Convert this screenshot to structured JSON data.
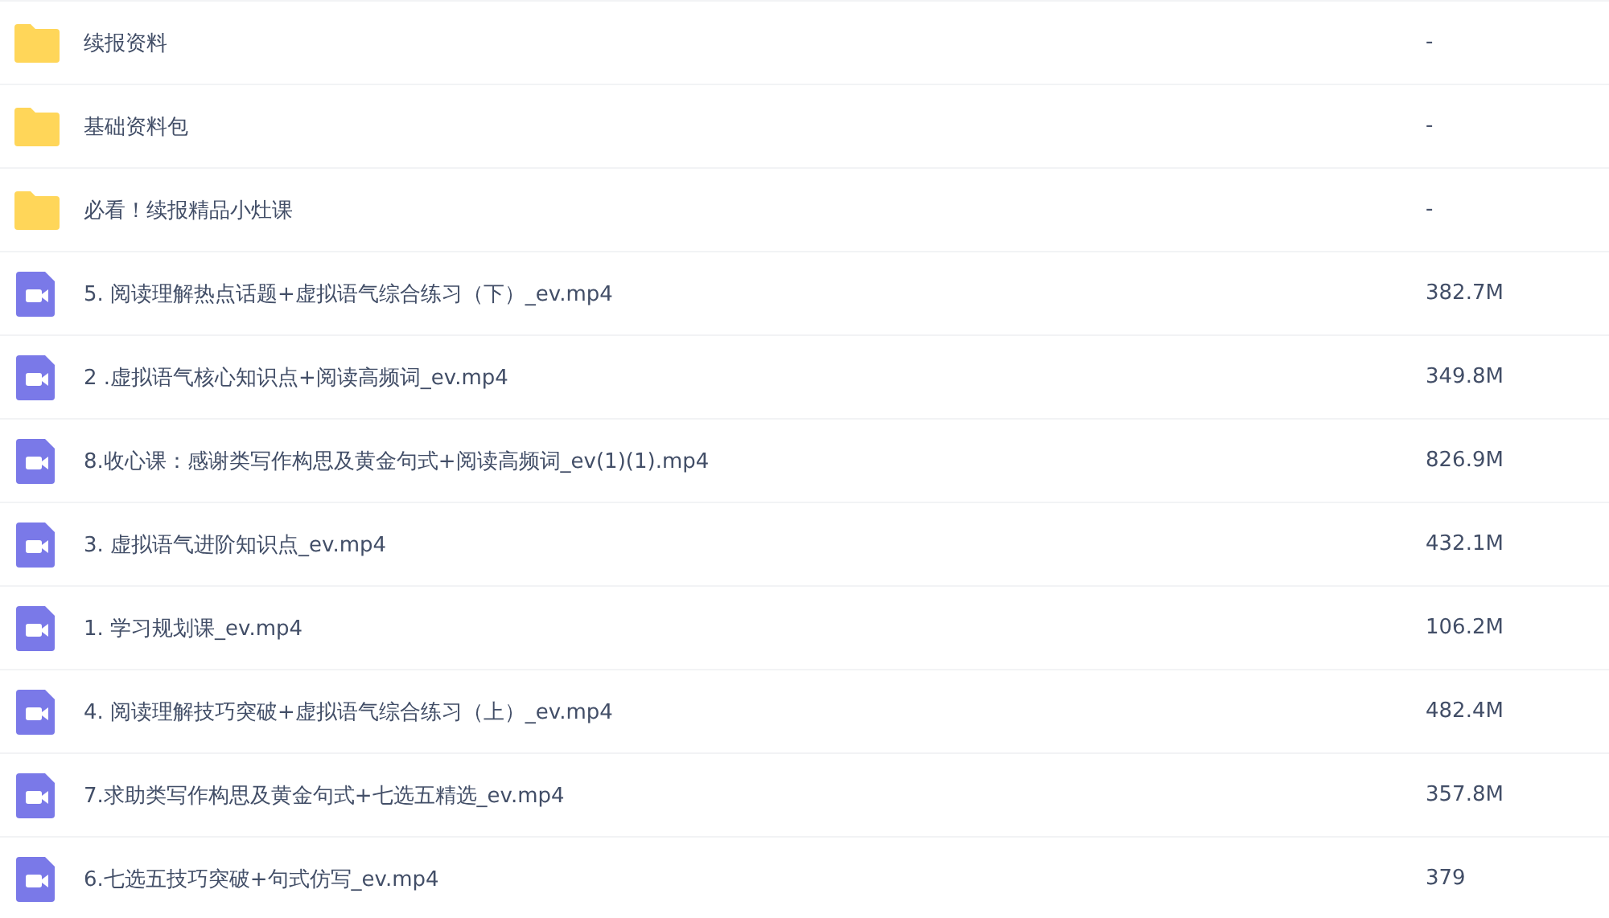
{
  "files": [
    {
      "kind": "folder",
      "name": "续报资料",
      "size": "-"
    },
    {
      "kind": "folder",
      "name": "基础资料包",
      "size": "-"
    },
    {
      "kind": "folder",
      "name": "必看！续报精品小灶课",
      "size": "-"
    },
    {
      "kind": "video",
      "name": "5. 阅读理解热点话题+虚拟语气综合练习（下）_ev.mp4",
      "size": "382.7M"
    },
    {
      "kind": "video",
      "name": "2 .虚拟语气核心知识点+阅读高频词_ev.mp4",
      "size": "349.8M"
    },
    {
      "kind": "video",
      "name": "8.收心课：感谢类写作构思及黄金句式+阅读高频词_ev(1)(1).mp4",
      "size": "826.9M"
    },
    {
      "kind": "video",
      "name": "3. 虚拟语气进阶知识点_ev.mp4",
      "size": "432.1M"
    },
    {
      "kind": "video",
      "name": "1. 学习规划课_ev.mp4",
      "size": "106.2M"
    },
    {
      "kind": "video",
      "name": "4. 阅读理解技巧突破+虚拟语气综合练习（上）_ev.mp4",
      "size": "482.4M"
    },
    {
      "kind": "video",
      "name": "7.求助类写作构思及黄金句式+七选五精选_ev.mp4",
      "size": "357.8M"
    },
    {
      "kind": "video",
      "name": "6.七选五技巧突破+句式仿写_ev.mp4",
      "size": "379"
    }
  ]
}
